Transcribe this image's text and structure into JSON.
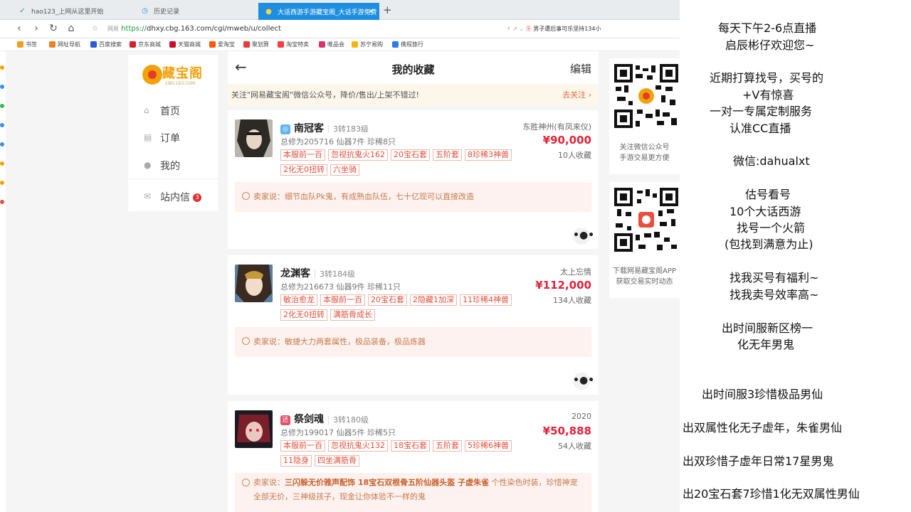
{
  "browser": {
    "tabs": [
      {
        "label": "hao123_上网从这里开始"
      },
      {
        "label": "历史记录"
      },
      {
        "label": "大话西游手游藏宝阁_大话手游免费"
      }
    ],
    "new_tab": "+",
    "url_site": "网易",
    "url_proto": "https://",
    "url_rest": "dhxy.cbg.163.com/cgi/mweb/u/collect",
    "search_hint": "男子遭后事可乐坚持134小",
    "bookmarks": [
      "书签",
      "网址导航",
      "百度搜索",
      "京东商城",
      "天猫商城",
      "爱淘宝",
      "聚划算",
      "淘宝特卖",
      "唯品会",
      "苏宁易购",
      "携程旅行"
    ],
    "colors": {
      "tab_active": "#1e8fe0",
      "accent": "#e0233a"
    }
  },
  "site": {
    "logo_text": "藏宝阁",
    "logo_sub": "CBG.163.COM",
    "nav": [
      {
        "label": "首页",
        "icon": "home-icon"
      },
      {
        "label": "订单",
        "icon": "order-icon"
      },
      {
        "label": "我的",
        "icon": "user-icon"
      },
      {
        "label": "站内信",
        "icon": "mail-icon",
        "badge": "3"
      }
    ]
  },
  "main": {
    "title": "我的收藏",
    "edit": "编辑",
    "notice": "关注\"网易藏宝阁\"微信公众号，降价/售出/上架不错过!",
    "notice_action": "去关注",
    "items": [
      {
        "name": "南冠客",
        "tag": "◎",
        "level": "3转183级",
        "stats": "总修为205716  仙器7件  珍稀8只",
        "chips": [
          "本服前一百",
          "忽视抗鬼火162",
          "20宝石套",
          "五阶套",
          "8珍稀3神兽",
          "2化无0扭转",
          "六坐骑"
        ],
        "server": "东胜神州(有凤来仪)",
        "price": "¥90,000",
        "favs": "10人收藏",
        "seller_prefix": "卖家说：",
        "seller_bold": "",
        "seller": "细节血队Pk鬼，有成熟血队伍，七十亿现可以直接改造"
      },
      {
        "name": "龙渊客",
        "tag": "",
        "level": "3转184级",
        "stats": "总修为216673  仙器9件  珍稀11只",
        "chips": [
          "敏治愈龙",
          "本服前一百",
          "20宝石套",
          "2隐藏1加深",
          "11珍稀4神兽",
          "2化无0扭转",
          "满筋骨成长"
        ],
        "server": "太上忘情",
        "price": "¥112,000",
        "favs": "134人收藏",
        "seller_prefix": "卖家说：",
        "seller_bold": "",
        "seller": "敏捷大力两套属性，极品装备，极品炼器"
      },
      {
        "name": "祭剑魂",
        "tag": "还",
        "level": "3转180级",
        "stats": "总修为199017  仙器5件  珍稀5只",
        "chips": [
          "本服前一百",
          "忽视抗鬼火132",
          "18宝石套",
          "五阶套",
          "5珍稀6神兽",
          "11隐身",
          "四坐满筋骨"
        ],
        "server": "2020",
        "price": "¥50,888",
        "favs": "54人收藏",
        "seller_prefix": "卖家说：",
        "seller_bold": "三闪躲无价雅声配饰 18宝石双根骨五阶仙器头盔 子虚朱雀",
        "seller": " 个性染色时装，珍惜神宠全部无价，三神级孩子，现金让你体验不一样的鬼"
      }
    ]
  },
  "qr": {
    "cap1_line1": "关注微信公众号",
    "cap1_line2": "手游交易更方便",
    "cap2_line1": "下载网易藏宝阁APP",
    "cap2_line2": "获取交易实时动态"
  },
  "overlay": {
    "lines": [
      "每天下午2-6点直播",
      "启辰彬仔欢迎您~",
      "近期打算找号，买号的",
      "+V有惊喜",
      "一对一专属定制服务",
      "认准CC直播",
      "微信:dahualxt",
      "估号看号",
      "10个大话西游",
      "找号一个火箭",
      "(包找到满意为止)",
      "找我买号有福利~",
      "找我卖号效率高~",
      "出时间服新区榜一",
      "化无年男鬼",
      "出时间服3珍惜极品男仙",
      "出双属性化无子虚年，朱雀男仙",
      "出双珍惜子虚年日常17星男鬼",
      "出20宝石套7珍惜1化无双属性男仙"
    ]
  }
}
